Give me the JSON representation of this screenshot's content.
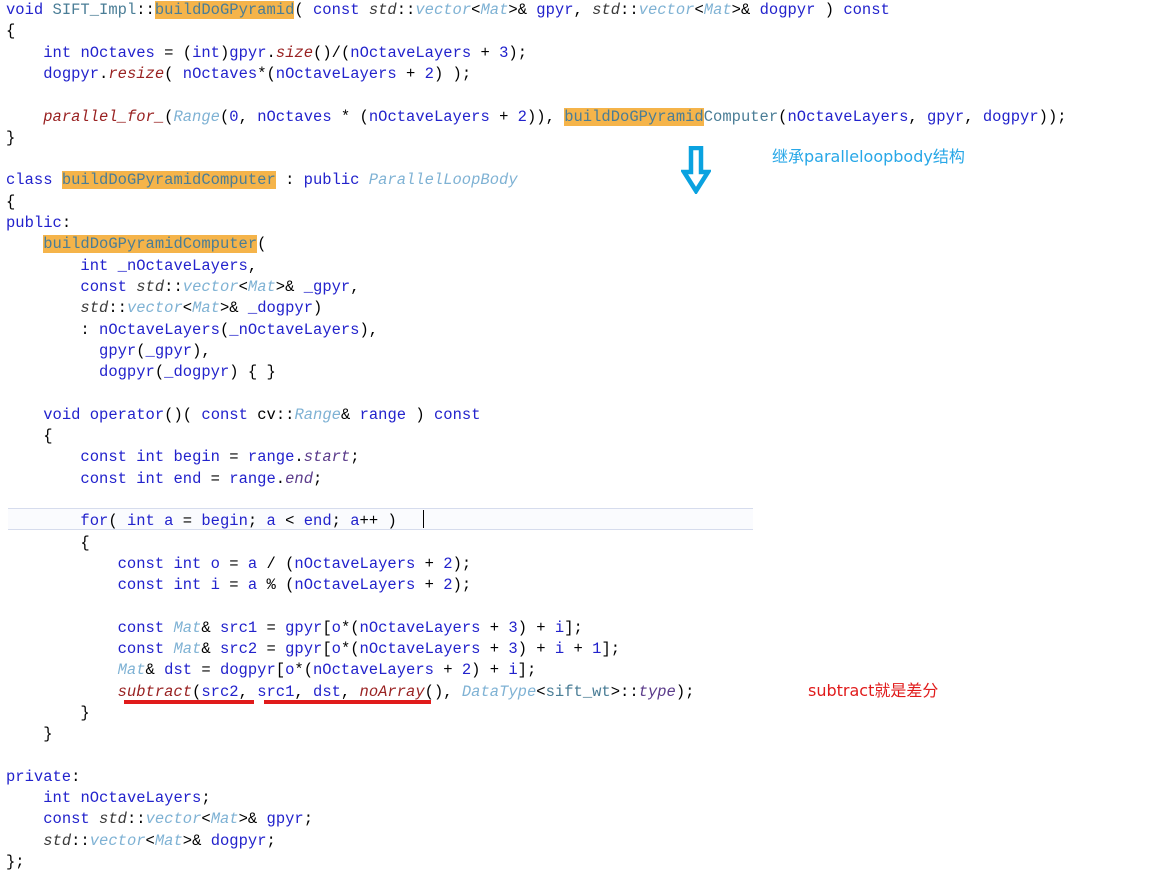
{
  "editor": {
    "language": "C++",
    "font_size_px": 15.5,
    "line_height_px": 21.3,
    "background": "#ffffff",
    "highlight_color": "#f5b44a",
    "current_line_background": "#fafbfe",
    "current_line_border": "#d6dced",
    "caret_visible": true
  },
  "code": {
    "lines": [
      "void SIFT_Impl::buildDoGPyramid( const std::vector<Mat>& gpyr, std::vector<Mat>& dogpyr ) const",
      "{",
      "    int nOctaves = (int)gpyr.size()/(nOctaveLayers + 3);",
      "    dogpyr.resize( nOctaves*(nOctaveLayers + 2) );",
      "",
      "    parallel_for_(Range(0, nOctaves * (nOctaveLayers + 2)), buildDoGPyramidComputer(nOctaveLayers, gpyr, dogpyr));",
      "}",
      "",
      "class buildDoGPyramidComputer : public ParallelLoopBody",
      "{",
      "public:",
      "    buildDoGPyramidComputer(",
      "        int _nOctaveLayers,",
      "        const std::vector<Mat>& _gpyr,",
      "        std::vector<Mat>& _dogpyr)",
      "        : nOctaveLayers(_nOctaveLayers),",
      "          gpyr(_gpyr),",
      "          dogpyr(_dogpyr) { }",
      "",
      "    void operator()( const cv::Range& range ) const",
      "    {",
      "        const int begin = range.start;",
      "        const int end = range.end;",
      "",
      "        for( int a = begin; a < end; a++ )",
      "        {",
      "            const int o = a / (nOctaveLayers + 2);",
      "            const int i = a % (nOctaveLayers + 2);",
      "",
      "            const Mat& src1 = gpyr[o*(nOctaveLayers + 3) + i];",
      "            const Mat& src2 = gpyr[o*(nOctaveLayers + 3) + i + 1];",
      "            Mat& dst = dogpyr[o*(nOctaveLayers + 2) + i];",
      "            subtract(src2, src1, dst, noArray(), DataType<sift_wt>::type);",
      "        }",
      "    }",
      "",
      "private:",
      "    int nOctaveLayers;",
      "    const std::vector<Mat>& gpyr;",
      "    std::vector<Mat>& dogpyr;",
      "};"
    ],
    "highlighted_token": "buildDoGPyramid",
    "highlighted_occurrences": [
      "buildDoGPyramid",
      "buildDoGPyramid",
      "buildDoGPyramidComputer",
      "buildDoGPyramidComputer"
    ],
    "current_line_text": "        for( int a = begin; a < end; a++ )"
  },
  "tokens": {
    "l0": {
      "kw1": "void",
      "cls": "SIFT_Impl",
      "sep": "::",
      "hl": "buildDoGPyramid",
      "p1": "( ",
      "kw2": "const",
      "std1": "std",
      "cc1": "::",
      "vec1": "vector",
      "lt1": "<",
      "mat1": "Mat",
      "gt1": ">",
      "amp1": "& ",
      "id1": "gpyr",
      "p2": ", ",
      "std2": "std",
      "cc2": "::",
      "vec2": "vector",
      "lt2": "<",
      "mat2": "Mat",
      "gt2": ">",
      "amp2": "& ",
      "id2": "dogpyr",
      "p3": " ) ",
      "kw3": "const"
    },
    "l1": {
      "brace": "{"
    },
    "l2": {
      "kw": "int",
      "id": "nOctaves",
      "eq": " = (",
      "kw2": "int",
      "p": ")",
      "id2": "gpyr",
      "dot": ".",
      "fn": "size",
      "p2": "()/(",
      "id3": "nOctaveLayers",
      "op": " + ",
      "num": "3",
      "end": ");"
    },
    "l3": {
      "id": "dogpyr",
      "dot": ".",
      "fn": "resize",
      "p": "( ",
      "id2": "nOctaves",
      "star": "*(",
      "id3": "nOctaveLayers",
      "op": " + ",
      "num": "2",
      "end": ") );"
    },
    "l5": {
      "fn": "parallel_for_",
      "p": "(",
      "type": "Range",
      "p2": "(",
      "num": "0",
      "c1": ", ",
      "id": "nOctaves",
      "c2": " * (",
      "id2": "nOctaveLayers",
      "c3": " + ",
      "num2": "2",
      "c4": ")), ",
      "hl": "buildDoGPyramid",
      "rest": "Computer",
      "p3": "(",
      "id3": "nOctaveLayers",
      "c5": ", ",
      "id4": "gpyr",
      "c6": ", ",
      "id5": "dogpyr",
      "end": "));"
    },
    "l6": {
      "brace": "}"
    },
    "l8": {
      "kw": "class",
      "hl": "buildDoGPyramidComputer",
      "colon": " : ",
      "kw2": "public",
      "type": "ParallelLoopBody"
    },
    "l10": {
      "kw": "public",
      "colon": ":"
    },
    "l11": {
      "hl": "buildDoGPyramidComputer",
      "p": "("
    },
    "l12": {
      "kw": "int",
      "id": "_nOctaveLayers",
      "c": ","
    },
    "l13": {
      "kw": "const",
      "std": "std",
      "cc": "::",
      "vec": "vector",
      "lt": "<",
      "mat": "Mat",
      "gt": ">",
      "amp": "& ",
      "id": "_gpyr",
      "c": ","
    },
    "l14": {
      "std": "std",
      "cc": "::",
      "vec": "vector",
      "lt": "<",
      "mat": "Mat",
      "gt": ">",
      "amp": "& ",
      "id": "_dogpyr",
      "p": ")"
    },
    "l15": {
      "colon": ": ",
      "id": "nOctaveLayers",
      "p": "(",
      "id2": "_nOctaveLayers",
      "end": "),"
    },
    "l16": {
      "id": "gpyr",
      "p": "(",
      "id2": "_gpyr",
      "end": "),"
    },
    "l17": {
      "id": "dogpyr",
      "p": "(",
      "id2": "_dogpyr",
      "end": ") { }"
    },
    "l19": {
      "kw": "void",
      "fn": "operator",
      "p": "()( ",
      "kw2": "const",
      "ns": "cv",
      "cc": "::",
      "type": "Range",
      "amp": "& ",
      "id": "range",
      "p2": " ) ",
      "kw3": "const"
    },
    "l21": {
      "kw": "const",
      "kw2": "int",
      "id": "begin",
      "eq": " = ",
      "id2": "range",
      "dot": ".",
      "memb": "start",
      "end": ";"
    },
    "l22": {
      "kw": "const",
      "kw2": "int",
      "id": "end",
      "eq": " = ",
      "id2": "range",
      "dot": ".",
      "memb": "end",
      "end": ";"
    },
    "l24": {
      "kw": "for",
      "p": "( ",
      "kw2": "int",
      "id": "a",
      "eq": " = ",
      "id2": "begin",
      "c": "; ",
      "id3": "a",
      "lt": " < ",
      "id4": "end",
      "c2": "; ",
      "id5": "a",
      "pp": "++ )"
    },
    "l26": {
      "kw": "const",
      "kw2": "int",
      "id": "o",
      "eq": " = ",
      "id2": "a",
      "op": " / (",
      "id3": "nOctaveLayers",
      "op2": " + ",
      "num": "2",
      "end": ");"
    },
    "l27": {
      "kw": "const",
      "kw2": "int",
      "id": "i",
      "eq": " = ",
      "id2": "a",
      "op": " % (",
      "id3": "nOctaveLayers",
      "op2": " + ",
      "num": "2",
      "end": ");"
    },
    "l29": {
      "kw": "const",
      "type": "Mat",
      "amp": "& ",
      "id": "src1",
      "eq": " = ",
      "id2": "gpyr",
      "br": "[",
      "id3": "o",
      "star": "*(",
      "id4": "nOctaveLayers",
      "op": " + ",
      "num": "3",
      "p": ") + ",
      "id5": "i",
      "end": "];"
    },
    "l30": {
      "kw": "const",
      "type": "Mat",
      "amp": "& ",
      "id": "src2",
      "eq": " = ",
      "id2": "gpyr",
      "br": "[",
      "id3": "o",
      "star": "*(",
      "id4": "nOctaveLayers",
      "op": " + ",
      "num": "3",
      "p": ") + ",
      "id5": "i",
      "op2": " + ",
      "num2": "1",
      "end": "];"
    },
    "l31": {
      "type": "Mat",
      "amp": "& ",
      "id": "dst",
      "eq": " = ",
      "id2": "dogpyr",
      "br": "[",
      "id3": "o",
      "star": "*(",
      "id4": "nOctaveLayers",
      "op": " + ",
      "num": "2",
      "p": ") + ",
      "id5": "i",
      "end": "];"
    },
    "l32": {
      "fn": "subtract",
      "p": "(",
      "id": "src2",
      "c": ", ",
      "id2": "src1",
      "c2": ", ",
      "id3": "dst",
      "c3": ", ",
      "fn2": "noArray",
      "p2": "(), ",
      "type": "DataType",
      "lt": "<",
      "cls": "sift_wt",
      "gt": ">",
      "cc": "::",
      "memb": "type",
      "end": ");"
    },
    "l36": {
      "kw": "private",
      "colon": ":"
    },
    "l37": {
      "kw": "int",
      "id": "nOctaveLayers",
      "end": ";"
    },
    "l38": {
      "kw": "const",
      "std": "std",
      "cc": "::",
      "vec": "vector",
      "lt": "<",
      "mat": "Mat",
      "gt": ">",
      "amp": "& ",
      "id": "gpyr",
      "end": ";"
    },
    "l39": {
      "std": "std",
      "cc": "::",
      "vec": "vector",
      "lt": "<",
      "mat": "Mat",
      "gt": ">",
      "amp": "& ",
      "id": "dogpyr",
      "end": ";"
    },
    "l40": {
      "end": "};"
    }
  },
  "annotations": [
    {
      "id": "inherit-note",
      "text": "继承paralleloopbody结构",
      "color": "#27a7e7",
      "kind": "text-note"
    },
    {
      "id": "subtract-note",
      "text": "subtract就是差分",
      "color": "#e01b1b",
      "kind": "text-note"
    },
    {
      "id": "down-arrow",
      "kind": "arrow",
      "direction": "down",
      "color": "#0aa2e0"
    },
    {
      "id": "red-underline",
      "kind": "underline",
      "color": "#e01b1b",
      "target": "subtract(src2, src1, dst, noArray"
    }
  ]
}
